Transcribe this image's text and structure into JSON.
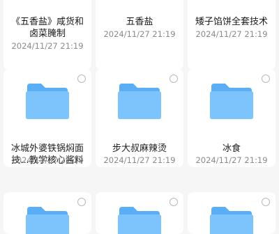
{
  "items": [
    {
      "name": "《五香盐》咸货和\n卤菜腌制",
      "date": "2024/11/27 21:19"
    },
    {
      "name": "五香盐",
      "date": "2024/11/27 21:19"
    },
    {
      "name": "矮子馅饼全套技术",
      "date": "2024/11/27 21:19"
    },
    {
      "name": "冰城外婆铁锅焖面\n技...教学核心酱料",
      "date": "2024/11/27 21:19"
    },
    {
      "name": "步大叔麻辣烫",
      "date": "2024/11/27 21:19"
    },
    {
      "name": "冰食",
      "date": "2024/11/27 21:19"
    }
  ],
  "colors": {
    "folder_back": "#5aaef5",
    "folder_front": "#7cc4fb",
    "folder_tab": "#4fa3ee"
  }
}
